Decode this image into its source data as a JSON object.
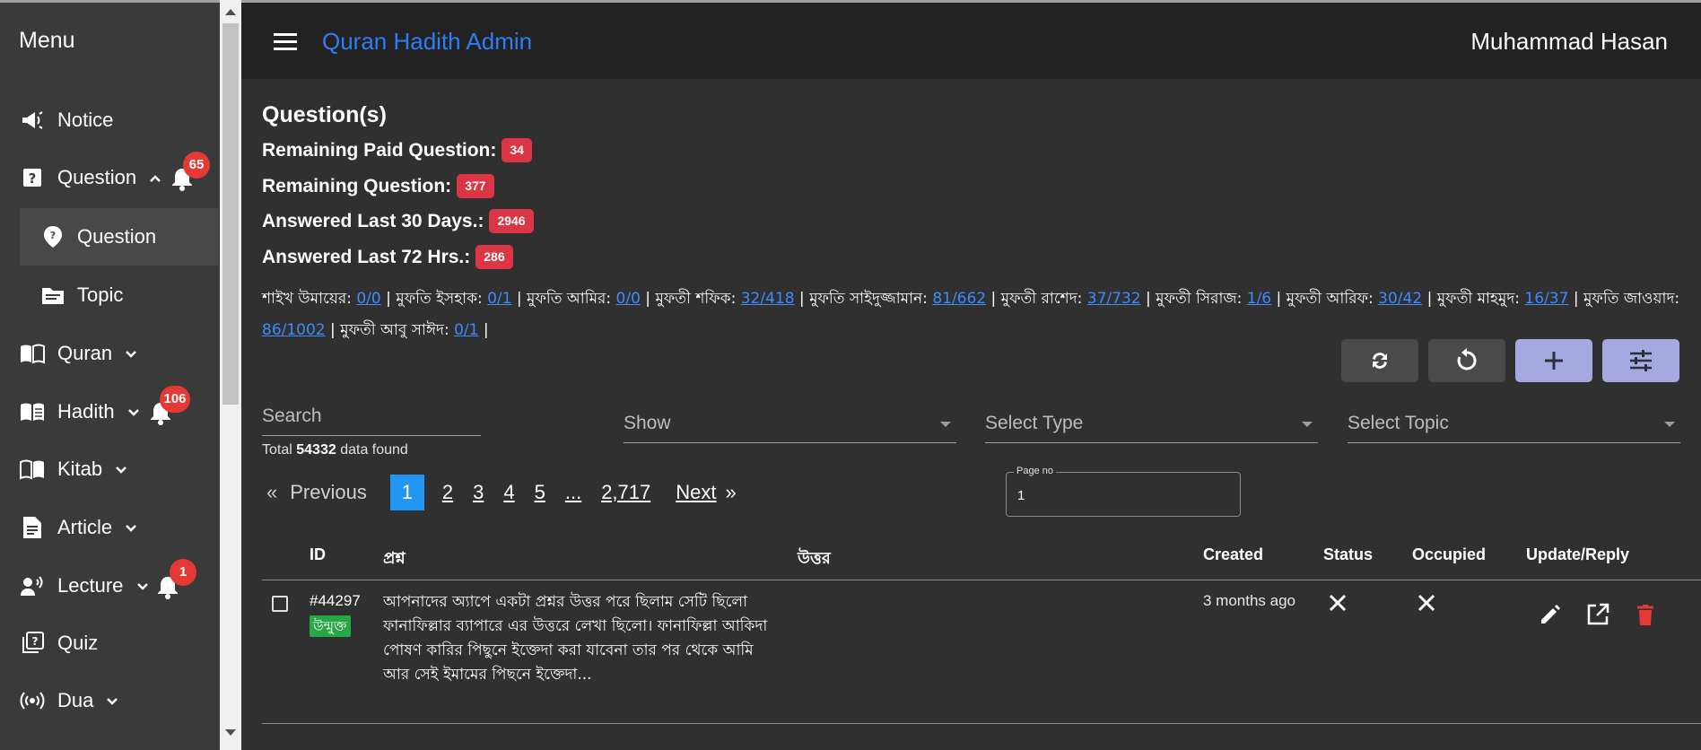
{
  "sidebar": {
    "title": "Menu",
    "items": [
      {
        "label": "Notice"
      },
      {
        "label": "Question",
        "badge": "65"
      },
      {
        "label": "Question"
      },
      {
        "label": "Topic"
      },
      {
        "label": "Quran"
      },
      {
        "label": "Hadith",
        "badge": "106"
      },
      {
        "label": "Kitab"
      },
      {
        "label": "Article"
      },
      {
        "label": "Lecture",
        "badge": "1"
      },
      {
        "label": "Quiz"
      },
      {
        "label": "Dua"
      }
    ]
  },
  "header": {
    "app_title": "Quran Hadith Admin",
    "user_name": "Muhammad Hasan"
  },
  "page": {
    "title": "Question(s)",
    "stats": [
      {
        "label": "Remaining Paid Question:",
        "value": "34"
      },
      {
        "label": "Remaining Question:",
        "value": "377"
      },
      {
        "label": "Answered Last 30 Days.:",
        "value": "2946"
      },
      {
        "label": "Answered Last 72 Hrs.:",
        "value": "286"
      }
    ],
    "muftis": [
      {
        "name": "শাইখ উমায়ের:",
        "count": "0/0"
      },
      {
        "name": "মুফতি ইসহাক:",
        "count": "0/1"
      },
      {
        "name": "মুফতি আমির:",
        "count": "0/0"
      },
      {
        "name": "মুফতী শফিক:",
        "count": "32/418"
      },
      {
        "name": "মুফতি সাইদুজ্জামান:",
        "count": "81/662"
      },
      {
        "name": "মুফতী রাশেদ:",
        "count": "37/732"
      },
      {
        "name": "মুফতী সিরাজ:",
        "count": "1/6"
      },
      {
        "name": "মুফতী আরিফ:",
        "count": "30/42"
      },
      {
        "name": "মুফতী মাহমুদ:",
        "count": "16/37"
      },
      {
        "name": "মুফতি জাওয়াদ:",
        "count": "86/1002"
      },
      {
        "name": "মুফতী আবু সাঈদ:",
        "count": "0/1"
      }
    ]
  },
  "filters": {
    "search_placeholder": "Search",
    "show_placeholder": "Show",
    "type_placeholder": "Select Type",
    "topic_placeholder": "Select Topic",
    "total_prefix": "Total",
    "total_count": "54332",
    "total_suffix": "data found"
  },
  "pagination": {
    "first": "«",
    "previous": "Previous",
    "pages": [
      "1",
      "2",
      "3",
      "4",
      "5",
      "...",
      "2,717"
    ],
    "current": "1",
    "next": "Next",
    "last": "»",
    "page_no_label": "Page no",
    "page_no_value": "1"
  },
  "table": {
    "headers": {
      "id": "ID",
      "question": "প্রশ্ন",
      "answer": "উত্তর",
      "created": "Created",
      "status": "Status",
      "occupied": "Occupied",
      "update": "Update/Reply"
    },
    "rows": [
      {
        "id": "#44297",
        "status_pill": "উন্মুক্ত",
        "question": "আপনাদের অ্যাপে একটা প্রশ্নর উত্তর পরে ছিলাম সেটি ছিলো ফানাফিল্লার ব্যাপারে এর উত্তরে লেখা ছিলো। ফানাফিল্লা আকিদা পোষণ কারির পিছুনে ইক্তেদা করা যাবেনা তার পর থেকে আমি আর সেই ইমামের পিছনে ইক্তেদা...",
        "answer": "",
        "created": "3 months ago"
      }
    ]
  },
  "colors": {
    "brand": "#2f7df6",
    "badge": "#e53935",
    "stat_badge": "#dc3545",
    "page_current": "#2196f3",
    "status_green": "#28a745",
    "delete_red": "#e53935",
    "action_light": "#a5a9e0"
  },
  "icons": {
    "notice": "megaphone-icon",
    "question": "question-box-icon",
    "question_sub": "map-pin-question-icon",
    "topic": "folder-icon",
    "quran": "open-book-icon",
    "hadith": "book-open-lines-icon",
    "kitab": "book-icon",
    "article": "document-icon",
    "lecture": "speaker-person-icon",
    "quiz": "quiz-icon",
    "dua": "broadcast-icon",
    "bell": "bell-icon",
    "sync": "sync-icon",
    "reload": "reload-icon",
    "add": "plus-icon",
    "filters": "sliders-icon",
    "edit": "pencil-icon",
    "open": "external-link-icon",
    "delete": "trash-icon",
    "close": "close-icon"
  }
}
